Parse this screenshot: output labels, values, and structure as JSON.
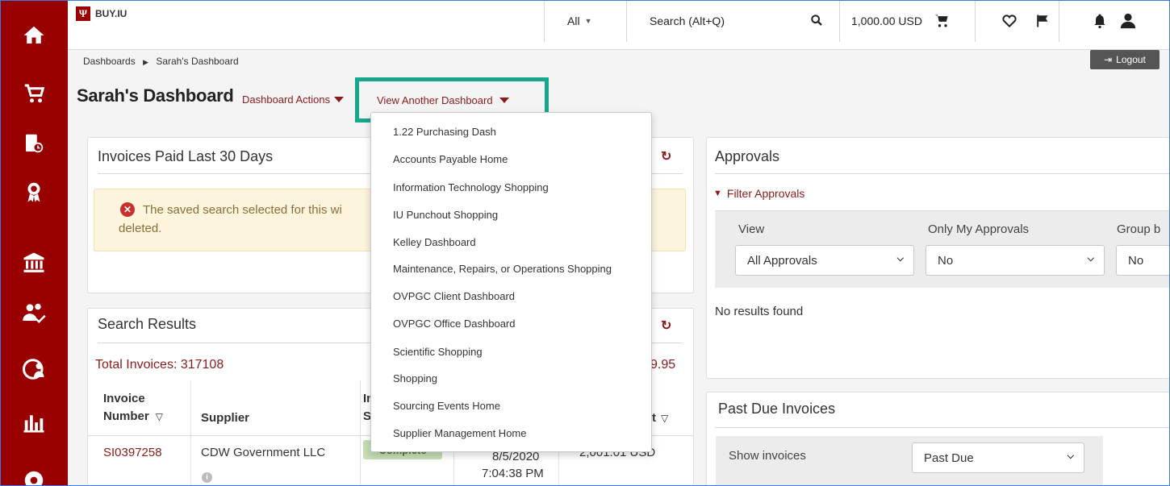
{
  "brand": {
    "logo_glyph": "Ψ",
    "name": "BUY.IU"
  },
  "sidebar": {
    "icons": [
      "home-icon",
      "cart-icon",
      "orders-clock-icon",
      "award-icon",
      "bank-icon",
      "people-check-icon",
      "globe-people-icon",
      "bar-chart-icon",
      "gear-icon"
    ]
  },
  "topbar": {
    "search_scope": "All",
    "search_placeholder": "Search (Alt+Q)",
    "cart_total": "1,000.00 USD"
  },
  "breadcrumb": {
    "root": "Dashboards",
    "current": "Sarah's Dashboard"
  },
  "logout_label": "Logout",
  "page_title": "Sarah's Dashboard",
  "dashboard_actions_label": "Dashboard Actions",
  "view_another_label": "View Another Dashboard",
  "dropdown_items": [
    "1.22 Purchasing Dash",
    "Accounts Payable Home",
    "Information Technology Shopping",
    "IU Punchout Shopping",
    "Kelley Dashboard",
    "Maintenance, Repairs, or Operations Shopping",
    "OVPGC Client Dashboard",
    "OVPGC Office Dashboard",
    "Scientific Shopping",
    "Shopping",
    "Sourcing Events Home",
    "Supplier Management Home"
  ],
  "invoices_paid": {
    "title": "Invoices Paid Last 30 Days",
    "alert_line1": "The saved search selected for this wi",
    "alert_line2": "deleted."
  },
  "search_results": {
    "title": "Search Results",
    "total_label": "Total Invoices: 317108",
    "total_right": "9.95",
    "columns": {
      "invoice_l1": "Invoice",
      "invoice_l2": "Number",
      "supplier": "Supplier",
      "status_l1": "In",
      "status_l2": "St",
      "amount_suffix": "t"
    },
    "row": {
      "invoice": "SI0397258",
      "supplier": "CDW Government LLC",
      "status": "Complete",
      "date": "8/5/2020",
      "time": "7:04:38 PM",
      "amount": "2,001.01 USD"
    }
  },
  "approvals": {
    "title": "Approvals",
    "filter_label": "Filter Approvals",
    "view_label": "View",
    "view_value": "All Approvals",
    "only_mine_label": "Only My Approvals",
    "only_mine_value": "No",
    "group_label": "Group b",
    "group_value": "No",
    "no_results": "No results found"
  },
  "past_due": {
    "title": "Past Due Invoices",
    "show_label": "Show invoices",
    "show_value": "Past Due"
  },
  "colors": {
    "brand_red": "#990000",
    "link_red": "#8a1b1b",
    "highlight_teal": "#17a68c"
  }
}
